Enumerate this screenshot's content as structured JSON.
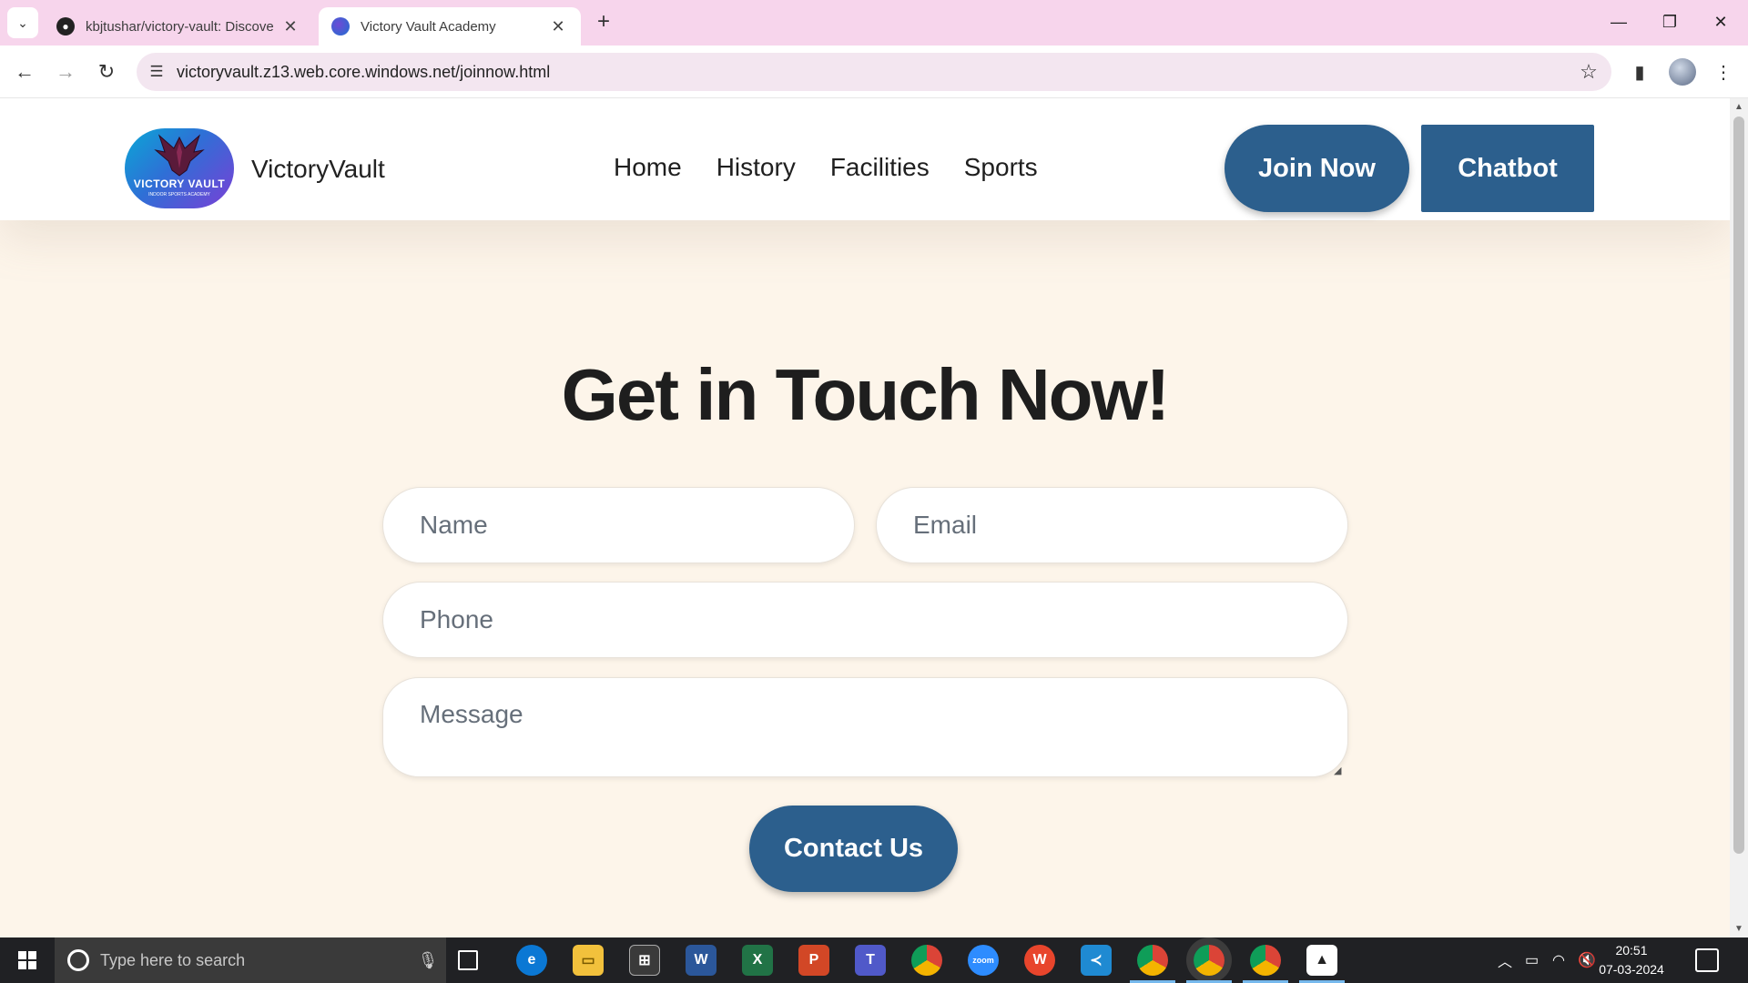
{
  "browser": {
    "tabs": [
      {
        "title": "kbjtushar/victory-vault: Discove",
        "active": false,
        "icon": "github-icon"
      },
      {
        "title": "Victory Vault Academy",
        "active": true,
        "icon": "victory-vault-favicon"
      }
    ],
    "new_tab_symbol": "+",
    "url": "victoryvault.z13.web.core.windows.net/joinnow.html",
    "window_controls": {
      "minimize": "—",
      "restore": "❐",
      "close": "✕"
    }
  },
  "site": {
    "logo": {
      "line1": "VICTORY VAULT",
      "line2": "INDOOR SPORTS ACADEMY"
    },
    "brand": "VictoryVault",
    "nav": [
      "Home",
      "History",
      "Facilities",
      "Sports"
    ],
    "join_button": "Join Now",
    "chatbot_button": "Chatbot"
  },
  "contact": {
    "heading": "Get in Touch Now!",
    "name_placeholder": "Name",
    "email_placeholder": "Email",
    "phone_placeholder": "Phone",
    "message_placeholder": "Message",
    "submit_label": "Contact Us"
  },
  "taskbar": {
    "search_placeholder": "Type here to search",
    "time": "20:51",
    "date": "07-03-2024",
    "apps": [
      "task-view",
      "edge",
      "file-explorer",
      "store",
      "word",
      "excel",
      "powerpoint",
      "teams",
      "chrome",
      "zoom",
      "wps",
      "vscode",
      "chrome-profile",
      "chrome-active",
      "chrome-profile-2",
      "photos"
    ]
  },
  "colors": {
    "accent": "#2c5f8d",
    "page_bg": "#fdf5ea",
    "tabbar_bg": "#f7d5ec",
    "taskbar_bg": "#202124"
  }
}
